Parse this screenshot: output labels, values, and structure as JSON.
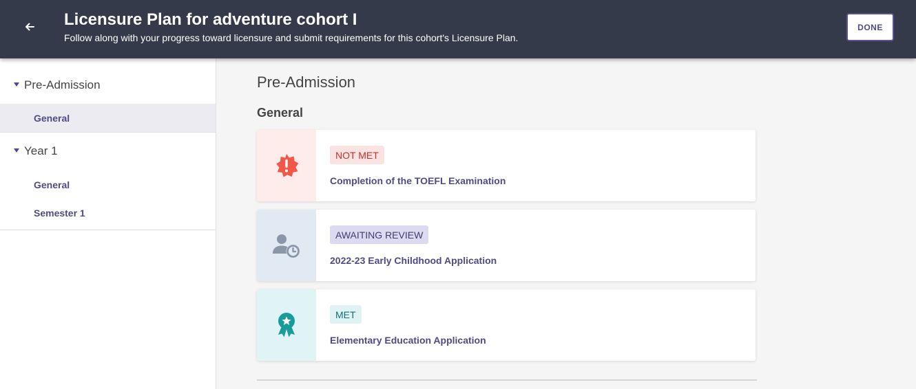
{
  "header": {
    "title": "Licensure Plan for adventure cohort I",
    "subtitle": "Follow along with your progress toward licensure and submit requirements for this cohort's Licensure Plan.",
    "back_icon": "arrow-left-icon",
    "done_label": "DONE"
  },
  "sidebar": {
    "sections": [
      {
        "label": "Pre-Admission",
        "items": [
          {
            "label": "General",
            "active": true
          }
        ]
      },
      {
        "label": "Year 1",
        "items": [
          {
            "label": "General",
            "active": false
          },
          {
            "label": "Semester 1",
            "active": false
          }
        ]
      }
    ]
  },
  "main": {
    "heading": "Pre-Admission",
    "subheading": "General",
    "cards": [
      {
        "status": "NOT MET",
        "title": "Completion of the TOEFL Examination",
        "icon": "alert-badge-icon",
        "icon_color": "#f2584a",
        "icon_bg": "#fdecea",
        "badge_bg": "#fbe3e1",
        "badge_color": "#c0312b"
      },
      {
        "status": "AWAITING REVIEW",
        "title": "2022-23 Early Childhood Application",
        "icon": "user-clock-icon",
        "icon_color": "#8a97a8",
        "icon_bg": "#e1e9f2",
        "badge_bg": "#dcdaf0",
        "badge_color": "#403b70"
      },
      {
        "status": "MET",
        "title": "Elementary Education Application",
        "icon": "award-ribbon-icon",
        "icon_color": "#1a9b9b",
        "icon_bg": "#e0f4f6",
        "badge_bg": "#dff3f5",
        "badge_color": "#14706f"
      }
    ]
  }
}
